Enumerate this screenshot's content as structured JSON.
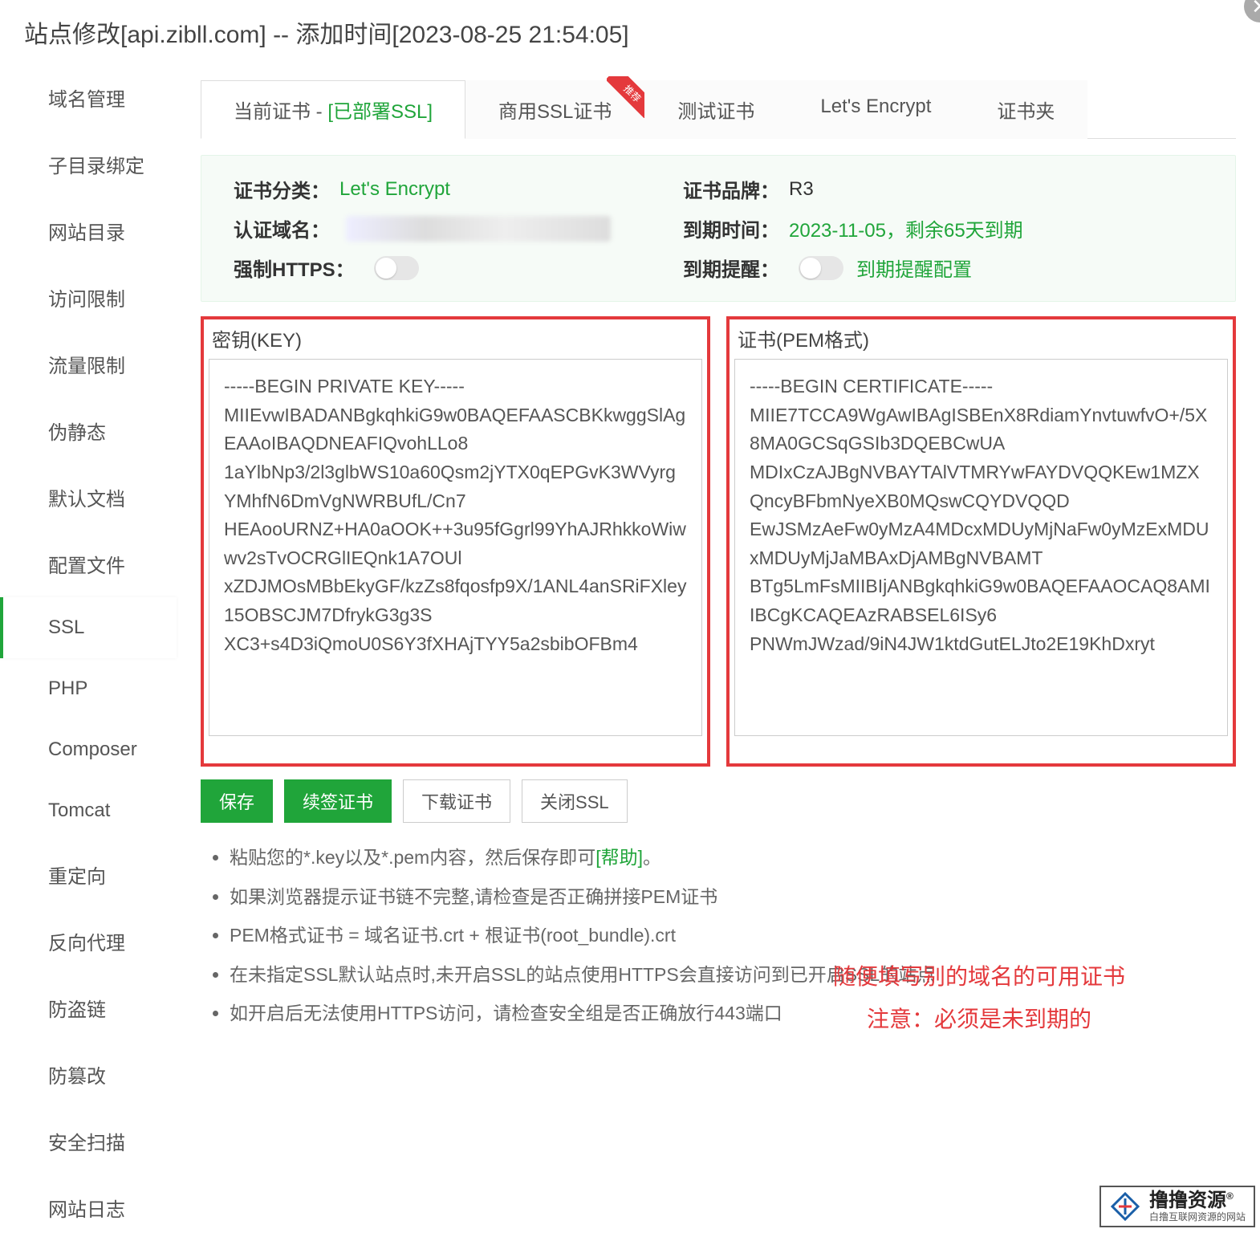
{
  "header": {
    "title": "站点修改[api.zibll.com] -- 添加时间[2023-08-25 21:54:05]"
  },
  "sidebar": {
    "items": [
      "域名管理",
      "子目录绑定",
      "网站目录",
      "访问限制",
      "流量限制",
      "伪静态",
      "默认文档",
      "配置文件",
      "SSL",
      "PHP",
      "Composer",
      "Tomcat",
      "重定向",
      "反向代理",
      "防盗链",
      "防篡改",
      "安全扫描",
      "网站日志"
    ],
    "active": "SSL"
  },
  "tabs": {
    "current_prefix": "当前证书 - ",
    "current_status": "[已部署SSL]",
    "commercial": "商用SSL证书",
    "test": "测试证书",
    "letsencrypt": "Let's Encrypt",
    "folder": "证书夹"
  },
  "summary": {
    "category_label": "证书分类：",
    "category_value": "Let's Encrypt",
    "brand_label": "证书品牌：",
    "brand_value": "R3",
    "domain_label": "认证域名：",
    "expire_label": "到期时间：",
    "expire_value": "2023-11-05，剩余65天到期",
    "force_https_label": "强制HTTPS：",
    "reminder_label": "到期提醒：",
    "reminder_config": "到期提醒配置"
  },
  "cert": {
    "key_label": "密钥(KEY)",
    "pem_label": "证书(PEM格式)",
    "key_content": "-----BEGIN PRIVATE KEY-----\nMIIEvwIBADANBgkqhkiG9w0BAQEFAASCBKkwggSlAgEAAoIBAQDNEAFIQvohLLo8\n1aYlbNp3/2l3glbWS10a60Qsm2jYTX0qEPGvK3WVyrgYMhfN6DmVgNWRBUfL/Cn7\nHEAooURNZ+HA0aOOK++3u95fGgrl99YhAJRhkkoWiwwv2sTvOCRGlIEQnk1A7OUl\nxZDJMOsMBbEkyGF/kzZs8fqosfp9X/1ANL4anSRiFXley15OBSCJM7DfrykG3g3S\nXC3+s4D3iQmoU0S6Y3fXHAjTYY5a2sbibOFBm4",
    "pem_content": "-----BEGIN CERTIFICATE-----\nMIIE7TCCA9WgAwIBAgISBEnX8RdiamYnvtuwfvO+/5X8MA0GCSqGSIb3DQEBCwUA\nMDIxCzAJBgNVBAYTAlVTMRYwFAYDVQQKEw1MZXQncyBFbmNyeXB0MQswCQYDVQQD\nEwJSMzAeFw0yMzA4MDcxMDUyMjNaFw0yMzExMDUxMDUyMjJaMBAxDjAMBgNVBAMT\nBTg5LmFsMIIBIjANBgkqhkiG9w0BAQEFAAOCAQ8AMIIBCgKCAQEAzRABSEL6ISy6\nPNWmJWzad/9iN4JW1ktdGutELJto2E19KhDxryt"
  },
  "buttons": {
    "save": "保存",
    "renew": "续签证书",
    "download": "下载证书",
    "close": "关闭SSL"
  },
  "help": {
    "line1a": "粘贴您的*.key以及*.pem内容，然后保存即可",
    "line1b": "[帮助]",
    "line1c": "。",
    "line2": "如果浏览器提示证书链不完整,请检查是否正确拼接PEM证书",
    "line3": "PEM格式证书 = 域名证书.crt + 根证书(root_bundle).crt",
    "line4": "在未指定SSL默认站点时,未开启SSL的站点使用HTTPS会直接访问到已开启SSL的站点",
    "line5": "如开启后无法使用HTTPS访问，请检查安全组是否正确放行443端口"
  },
  "red_note": {
    "line1": "随便填写别的域名的可用证书",
    "line2": "注意：必须是未到期的"
  },
  "watermark": {
    "main": "撸撸资源",
    "reg": "®",
    "sub": "白撸互联网资源的网站"
  }
}
